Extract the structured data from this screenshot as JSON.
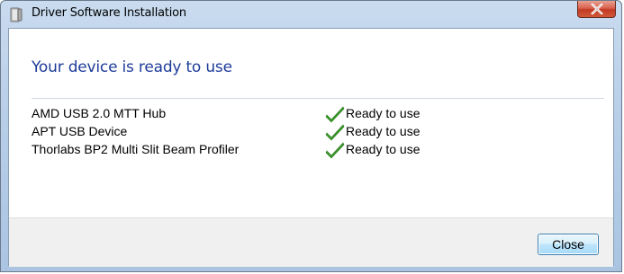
{
  "window": {
    "title": "Driver Software Installation",
    "close_icon": "close-icon"
  },
  "main": {
    "heading": "Your device is ready to use",
    "devices": [
      {
        "name": "AMD USB 2.0 MTT Hub",
        "status": "Ready to use",
        "status_icon": "checkmark-icon"
      },
      {
        "name": "APT USB Device",
        "status": "Ready to use",
        "status_icon": "checkmark-icon"
      },
      {
        "name": "Thorlabs BP2 Multi Slit Beam Profiler",
        "status": "Ready to use",
        "status_icon": "checkmark-icon"
      }
    ]
  },
  "footer": {
    "close_label": "Close"
  },
  "colors": {
    "heading": "#1e3c99",
    "checkmark": "#3a9a2a",
    "close_x_red": "#c23a22"
  }
}
